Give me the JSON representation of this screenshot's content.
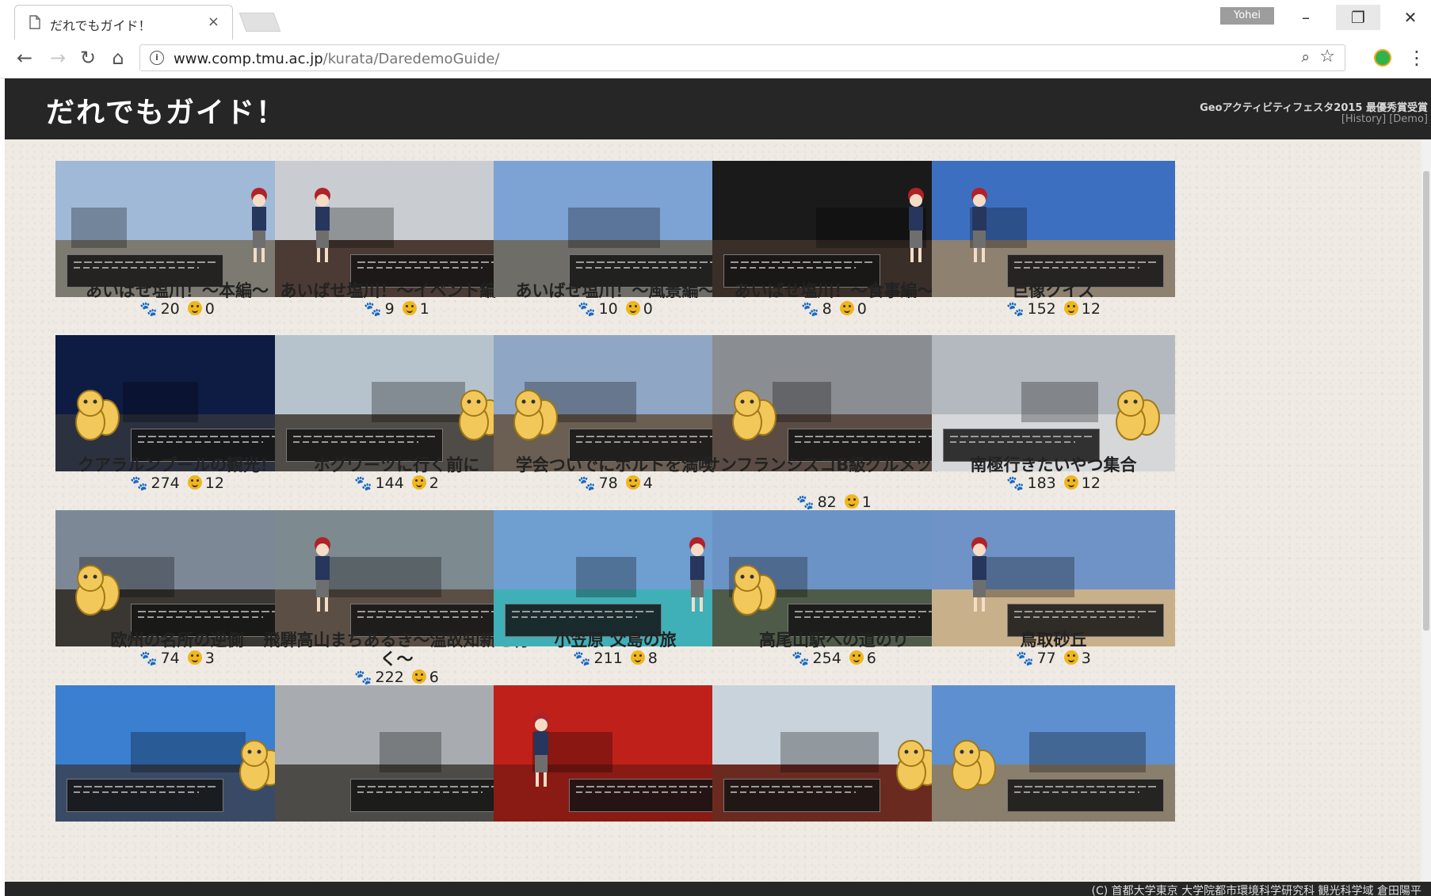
{
  "browser": {
    "tab_title": "だれでもガイド！",
    "tab_close": "×",
    "user_badge": "Yohei",
    "url_host": "www.comp.tmu.ac.jp",
    "url_path": "/kurata/DaredemoGuide/"
  },
  "site": {
    "title": "だれでもガイド！",
    "award": "Geoアクティビティフェスタ2015 最優秀賞受賞",
    "links": [
      "[History]",
      "[Demo]"
    ],
    "copyright": "(C) 首都大学東京 大学院都市環境科学研究科 観光科学域 倉田陽平"
  },
  "guides": [
    {
      "title": "あいばせ塩川！～本編～",
      "views": "20",
      "likes": "0"
    },
    {
      "title": "あいばせ塩川！～イベント編～",
      "views": "9",
      "likes": "1"
    },
    {
      "title": "あいばせ塩川！～風景編～",
      "views": "10",
      "likes": "0"
    },
    {
      "title": "あいばせ塩川！～食事編～",
      "views": "8",
      "likes": "0"
    },
    {
      "title": "巨像クイズ",
      "views": "152",
      "likes": "12"
    },
    {
      "title": "クアラルンプールの観光！",
      "views": "274",
      "likes": "12"
    },
    {
      "title": "ホグワーツに行く前に",
      "views": "144",
      "likes": "2"
    },
    {
      "title": "学会ついでにポルトを満喫",
      "views": "78",
      "likes": "4"
    },
    {
      "title": "サンフランシスコB級グルメツアー",
      "views": "82",
      "likes": "1"
    },
    {
      "title": "南極行きたいやつ集合",
      "views": "183",
      "likes": "12"
    },
    {
      "title": "欧州の名所の逆側",
      "views": "74",
      "likes": "3"
    },
    {
      "title": "飛騨高山まちあるき～温故知新を行く～",
      "views": "222",
      "likes": "6"
    },
    {
      "title": "小笠原 父島の旅",
      "views": "211",
      "likes": "8"
    },
    {
      "title": "高尾山駅への道のり",
      "views": "254",
      "likes": "6"
    },
    {
      "title": "鳥取砂丘",
      "views": "77",
      "likes": "3"
    },
    {
      "title": "",
      "views": "",
      "likes": ""
    },
    {
      "title": "",
      "views": "",
      "likes": ""
    },
    {
      "title": "",
      "views": "",
      "likes": ""
    },
    {
      "title": "",
      "views": "",
      "likes": ""
    },
    {
      "title": "",
      "views": "",
      "likes": ""
    }
  ],
  "thumb_colors": [
    {
      "sky": "#9fb9d6",
      "ground": "#7d7a72",
      "char": "guide"
    },
    {
      "sky": "#c9cdd2",
      "ground": "#4b3b34",
      "char": "guide"
    },
    {
      "sky": "#7da3d4",
      "ground": "#6f6d68",
      "char": "none"
    },
    {
      "sky": "#1a1a1a",
      "ground": "#3a2e28",
      "char": "guide"
    },
    {
      "sky": "#3d6fc0",
      "ground": "#8e8170",
      "char": "guide"
    },
    {
      "sky": "#0e1c44",
      "ground": "#2c3140",
      "char": "mascot"
    },
    {
      "sky": "#b7c3cc",
      "ground": "#4f4b46",
      "char": "mascot"
    },
    {
      "sky": "#8fa6c4",
      "ground": "#6b5e52",
      "char": "mascot"
    },
    {
      "sky": "#8a8d92",
      "ground": "#5a4c44",
      "char": "mascot"
    },
    {
      "sky": "#b4b9bf",
      "ground": "#d5d7d9",
      "char": "mascot"
    },
    {
      "sky": "#7c8896",
      "ground": "#3a3632",
      "char": "mascot"
    },
    {
      "sky": "#7d8a8f",
      "ground": "#5b4f45",
      "char": "guide"
    },
    {
      "sky": "#6f9ed0",
      "ground": "#3fb0b8",
      "char": "guide"
    },
    {
      "sky": "#6c93c6",
      "ground": "#4f5b49",
      "char": "mascot"
    },
    {
      "sky": "#6f93c6",
      "ground": "#c8b08a",
      "char": "guide"
    },
    {
      "sky": "#3a7fd0",
      "ground": "#394a66",
      "char": "mascot"
    },
    {
      "sky": "#a8acb0",
      "ground": "#4d4b47",
      "char": "none"
    },
    {
      "sky": "#c0201a",
      "ground": "#8a1a14",
      "char": "guide"
    },
    {
      "sky": "#c9d3dc",
      "ground": "#6b2a20",
      "char": "mascot"
    },
    {
      "sky": "#5e8fcf",
      "ground": "#8a7f6c",
      "char": "mascot"
    }
  ]
}
